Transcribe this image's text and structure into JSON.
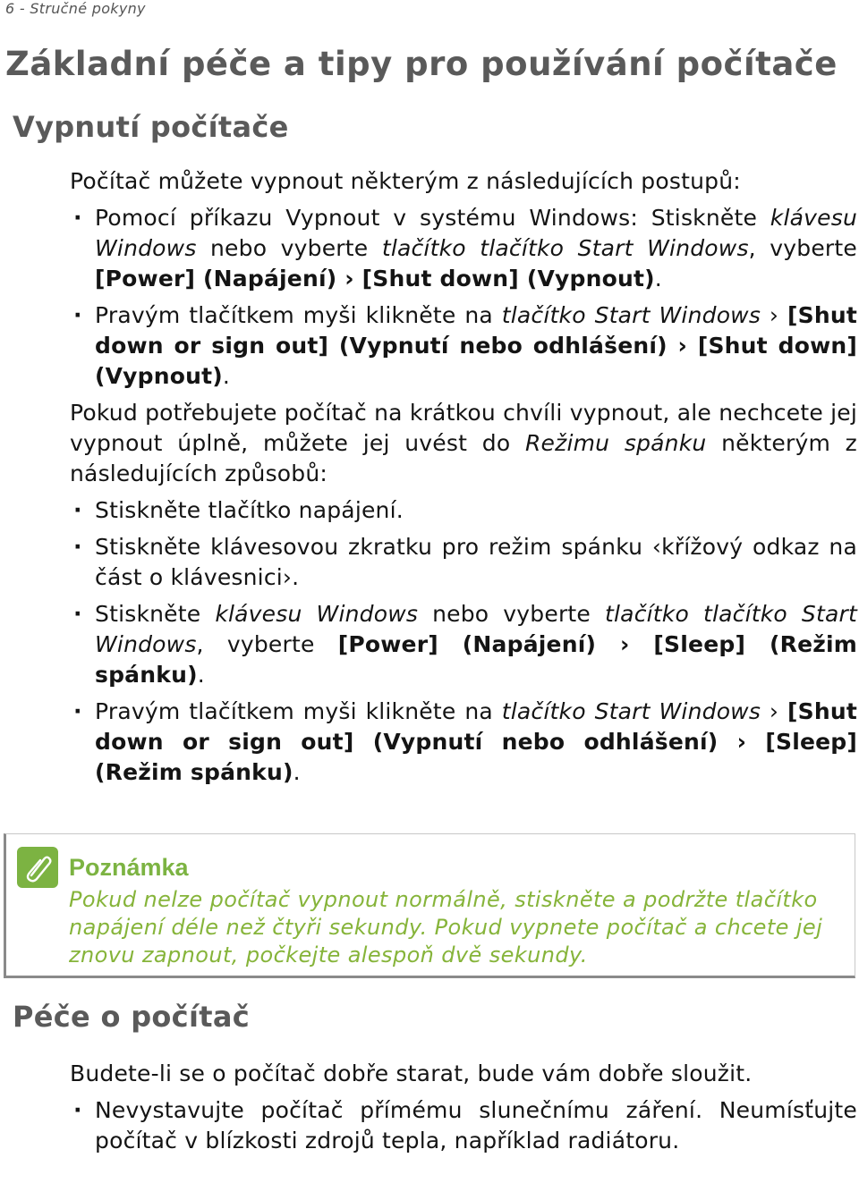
{
  "header": {
    "running_title": "6 - Stručné pokyny"
  },
  "title": "Základní péče a tipy pro používání počítače",
  "section_shutdown": {
    "heading": "Vypnutí počítače",
    "intro": "Počítač můžete vypnout některým z následujících postupů:",
    "bullet1": {
      "t1": "Pomocí příkazu Vypnout v systému Windows: Stiskněte ",
      "i1": "klávesu Windows",
      "t2": " nebo vyberte ",
      "i2": "tlačítko tlačítko Start Windows",
      "t3": ", vyberte ",
      "b1": "[Power] (Napájení) › [Shut down] (Vypnout)",
      "t4": "."
    },
    "bullet2": {
      "t1": "Pravým tlačítkem myši klikněte na ",
      "i1": "tlačítko Start Windows",
      "t2": " › ",
      "b1": "[Shut down or sign out] (Vypnutí nebo odhlášení) › [Shut down] (Vypnout)",
      "t3": "."
    },
    "sleep_intro": {
      "t1": "Pokud potřebujete počítač na krátkou chvíli vypnout, ale nechcete jej vypnout úplně, můžete jej uvést do ",
      "i1": "Režimu spánku",
      "t2": " některým z následujících způsobů:"
    },
    "sleep_bullet1": "Stiskněte tlačítko napájení.",
    "sleep_bullet2": "Stiskněte klávesovou zkratku pro režim spánku ‹křížový odkaz na část o klávesnici›.",
    "sleep_bullet3": {
      "t1": "Stiskněte ",
      "i1": "klávesu Windows",
      "t2": " nebo vyberte ",
      "i2": "tlačítko tlačítko Start Windows",
      "t3": ", vyberte ",
      "b1": "[Power] (Napájení) › [Sleep] (Režim spánku)",
      "t4": "."
    },
    "sleep_bullet4": {
      "t1": "Pravým tlačítkem myši klikněte na ",
      "i1": "tlačítko Start Windows",
      "t2": " › ",
      "b1": "[Shut down or sign out] (Vypnutí nebo odhlášení) › [Sleep] (Režim spánku)",
      "t3": "."
    }
  },
  "note": {
    "icon": "paperclip-icon",
    "title": "Poznámka",
    "text": "Pokud nelze počítač vypnout normálně, stiskněte a podržte tlačítko napájení déle než čtyři sekundy. Pokud vypnete počítač a chcete jej znovu zapnout, počkejte alespoň dvě sekundy.",
    "accent_color": "#7cb342"
  },
  "section_care": {
    "heading": "Péče o počítač",
    "intro": "Budete-li se o počítač dobře starat, bude vám dobře sloužit.",
    "bullet1": "Nevystavujte počítač přímému slunečnímu záření. Neumísťujte počítač v blízkosti zdrojů tepla, například radiátoru."
  },
  "bullet_glyph": "·"
}
